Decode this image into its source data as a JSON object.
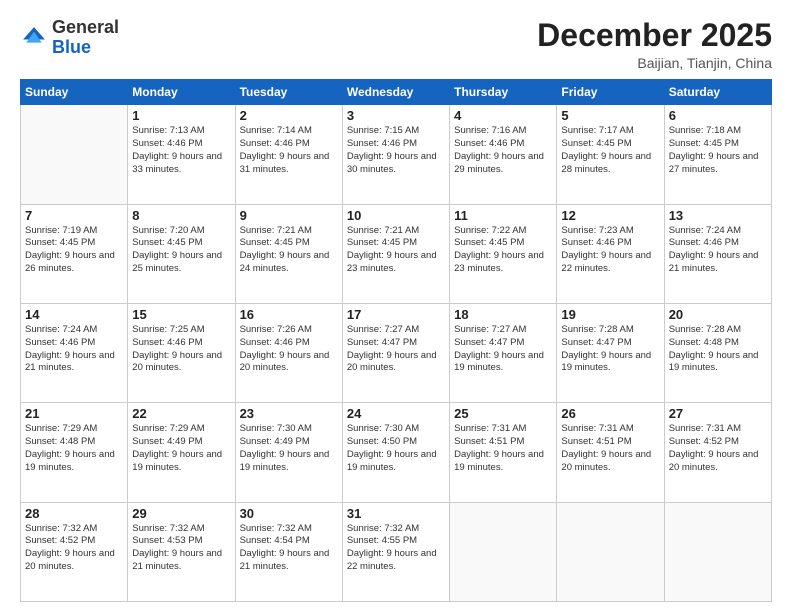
{
  "header": {
    "logo_general": "General",
    "logo_blue": "Blue",
    "month_title": "December 2025",
    "location": "Baijian, Tianjin, China"
  },
  "weekdays": [
    "Sunday",
    "Monday",
    "Tuesday",
    "Wednesday",
    "Thursday",
    "Friday",
    "Saturday"
  ],
  "weeks": [
    [
      {
        "day": "",
        "sunrise": "",
        "sunset": "",
        "daylight": ""
      },
      {
        "day": "1",
        "sunrise": "Sunrise: 7:13 AM",
        "sunset": "Sunset: 4:46 PM",
        "daylight": "Daylight: 9 hours and 33 minutes."
      },
      {
        "day": "2",
        "sunrise": "Sunrise: 7:14 AM",
        "sunset": "Sunset: 4:46 PM",
        "daylight": "Daylight: 9 hours and 31 minutes."
      },
      {
        "day": "3",
        "sunrise": "Sunrise: 7:15 AM",
        "sunset": "Sunset: 4:46 PM",
        "daylight": "Daylight: 9 hours and 30 minutes."
      },
      {
        "day": "4",
        "sunrise": "Sunrise: 7:16 AM",
        "sunset": "Sunset: 4:46 PM",
        "daylight": "Daylight: 9 hours and 29 minutes."
      },
      {
        "day": "5",
        "sunrise": "Sunrise: 7:17 AM",
        "sunset": "Sunset: 4:45 PM",
        "daylight": "Daylight: 9 hours and 28 minutes."
      },
      {
        "day": "6",
        "sunrise": "Sunrise: 7:18 AM",
        "sunset": "Sunset: 4:45 PM",
        "daylight": "Daylight: 9 hours and 27 minutes."
      }
    ],
    [
      {
        "day": "7",
        "sunrise": "Sunrise: 7:19 AM",
        "sunset": "Sunset: 4:45 PM",
        "daylight": "Daylight: 9 hours and 26 minutes."
      },
      {
        "day": "8",
        "sunrise": "Sunrise: 7:20 AM",
        "sunset": "Sunset: 4:45 PM",
        "daylight": "Daylight: 9 hours and 25 minutes."
      },
      {
        "day": "9",
        "sunrise": "Sunrise: 7:21 AM",
        "sunset": "Sunset: 4:45 PM",
        "daylight": "Daylight: 9 hours and 24 minutes."
      },
      {
        "day": "10",
        "sunrise": "Sunrise: 7:21 AM",
        "sunset": "Sunset: 4:45 PM",
        "daylight": "Daylight: 9 hours and 23 minutes."
      },
      {
        "day": "11",
        "sunrise": "Sunrise: 7:22 AM",
        "sunset": "Sunset: 4:45 PM",
        "daylight": "Daylight: 9 hours and 23 minutes."
      },
      {
        "day": "12",
        "sunrise": "Sunrise: 7:23 AM",
        "sunset": "Sunset: 4:46 PM",
        "daylight": "Daylight: 9 hours and 22 minutes."
      },
      {
        "day": "13",
        "sunrise": "Sunrise: 7:24 AM",
        "sunset": "Sunset: 4:46 PM",
        "daylight": "Daylight: 9 hours and 21 minutes."
      }
    ],
    [
      {
        "day": "14",
        "sunrise": "Sunrise: 7:24 AM",
        "sunset": "Sunset: 4:46 PM",
        "daylight": "Daylight: 9 hours and 21 minutes."
      },
      {
        "day": "15",
        "sunrise": "Sunrise: 7:25 AM",
        "sunset": "Sunset: 4:46 PM",
        "daylight": "Daylight: 9 hours and 20 minutes."
      },
      {
        "day": "16",
        "sunrise": "Sunrise: 7:26 AM",
        "sunset": "Sunset: 4:46 PM",
        "daylight": "Daylight: 9 hours and 20 minutes."
      },
      {
        "day": "17",
        "sunrise": "Sunrise: 7:27 AM",
        "sunset": "Sunset: 4:47 PM",
        "daylight": "Daylight: 9 hours and 20 minutes."
      },
      {
        "day": "18",
        "sunrise": "Sunrise: 7:27 AM",
        "sunset": "Sunset: 4:47 PM",
        "daylight": "Daylight: 9 hours and 19 minutes."
      },
      {
        "day": "19",
        "sunrise": "Sunrise: 7:28 AM",
        "sunset": "Sunset: 4:47 PM",
        "daylight": "Daylight: 9 hours and 19 minutes."
      },
      {
        "day": "20",
        "sunrise": "Sunrise: 7:28 AM",
        "sunset": "Sunset: 4:48 PM",
        "daylight": "Daylight: 9 hours and 19 minutes."
      }
    ],
    [
      {
        "day": "21",
        "sunrise": "Sunrise: 7:29 AM",
        "sunset": "Sunset: 4:48 PM",
        "daylight": "Daylight: 9 hours and 19 minutes."
      },
      {
        "day": "22",
        "sunrise": "Sunrise: 7:29 AM",
        "sunset": "Sunset: 4:49 PM",
        "daylight": "Daylight: 9 hours and 19 minutes."
      },
      {
        "day": "23",
        "sunrise": "Sunrise: 7:30 AM",
        "sunset": "Sunset: 4:49 PM",
        "daylight": "Daylight: 9 hours and 19 minutes."
      },
      {
        "day": "24",
        "sunrise": "Sunrise: 7:30 AM",
        "sunset": "Sunset: 4:50 PM",
        "daylight": "Daylight: 9 hours and 19 minutes."
      },
      {
        "day": "25",
        "sunrise": "Sunrise: 7:31 AM",
        "sunset": "Sunset: 4:51 PM",
        "daylight": "Daylight: 9 hours and 19 minutes."
      },
      {
        "day": "26",
        "sunrise": "Sunrise: 7:31 AM",
        "sunset": "Sunset: 4:51 PM",
        "daylight": "Daylight: 9 hours and 20 minutes."
      },
      {
        "day": "27",
        "sunrise": "Sunrise: 7:31 AM",
        "sunset": "Sunset: 4:52 PM",
        "daylight": "Daylight: 9 hours and 20 minutes."
      }
    ],
    [
      {
        "day": "28",
        "sunrise": "Sunrise: 7:32 AM",
        "sunset": "Sunset: 4:52 PM",
        "daylight": "Daylight: 9 hours and 20 minutes."
      },
      {
        "day": "29",
        "sunrise": "Sunrise: 7:32 AM",
        "sunset": "Sunset: 4:53 PM",
        "daylight": "Daylight: 9 hours and 21 minutes."
      },
      {
        "day": "30",
        "sunrise": "Sunrise: 7:32 AM",
        "sunset": "Sunset: 4:54 PM",
        "daylight": "Daylight: 9 hours and 21 minutes."
      },
      {
        "day": "31",
        "sunrise": "Sunrise: 7:32 AM",
        "sunset": "Sunset: 4:55 PM",
        "daylight": "Daylight: 9 hours and 22 minutes."
      },
      {
        "day": "",
        "sunrise": "",
        "sunset": "",
        "daylight": ""
      },
      {
        "day": "",
        "sunrise": "",
        "sunset": "",
        "daylight": ""
      },
      {
        "day": "",
        "sunrise": "",
        "sunset": "",
        "daylight": ""
      }
    ]
  ]
}
